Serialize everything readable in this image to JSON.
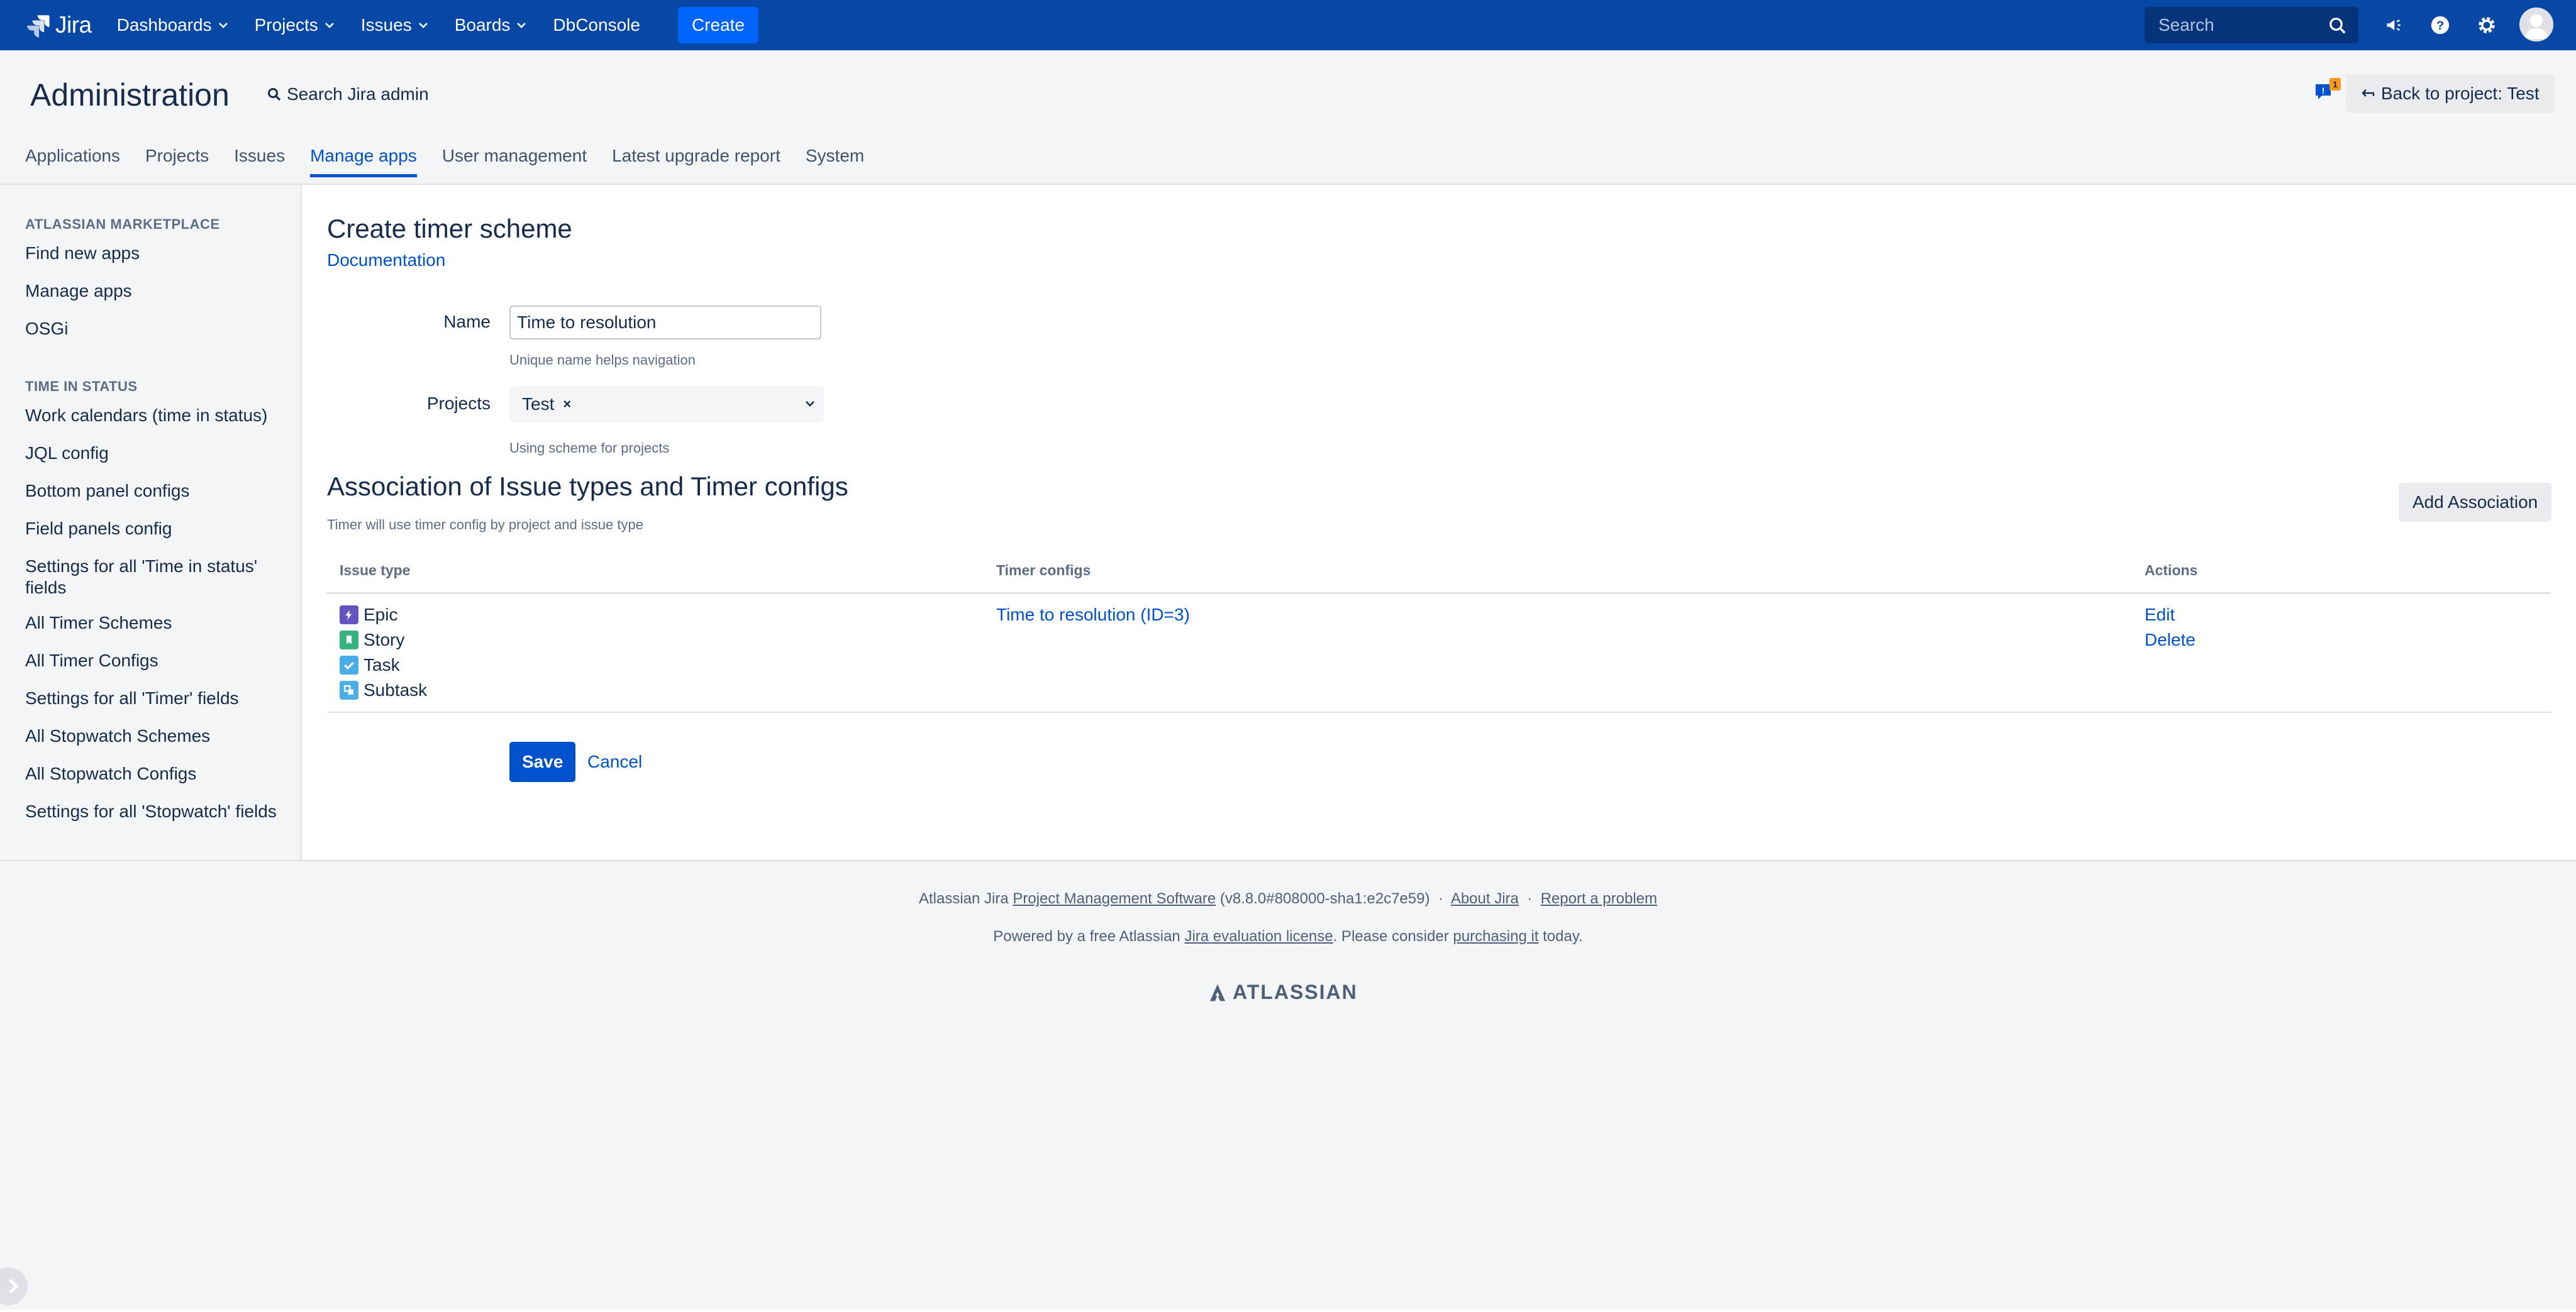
{
  "topnav": {
    "logo_text": "Jira",
    "items": [
      {
        "label": "Dashboards",
        "has_menu": true
      },
      {
        "label": "Projects",
        "has_menu": true
      },
      {
        "label": "Issues",
        "has_menu": true
      },
      {
        "label": "Boards",
        "has_menu": true
      },
      {
        "label": "DbConsole",
        "has_menu": false
      }
    ],
    "create_label": "Create",
    "search_placeholder": "Search",
    "notification_badge": "1"
  },
  "header": {
    "title": "Administration",
    "search_admin": "Search Jira admin",
    "back_button": "Back to project: Test"
  },
  "tabs": [
    {
      "label": "Applications",
      "active": false
    },
    {
      "label": "Projects",
      "active": false
    },
    {
      "label": "Issues",
      "active": false
    },
    {
      "label": "Manage apps",
      "active": true
    },
    {
      "label": "User management",
      "active": false
    },
    {
      "label": "Latest upgrade report",
      "active": false
    },
    {
      "label": "System",
      "active": false
    }
  ],
  "sidebar": {
    "marketplace_heading": "ATLASSIAN MARKETPLACE",
    "marketplace_items": [
      "Find new apps",
      "Manage apps",
      "OSGi"
    ],
    "tis_heading": "TIME IN STATUS",
    "tis_items": [
      "Work calendars (time in status)",
      "JQL config",
      "Bottom panel configs",
      "Field panels config",
      "Settings for all 'Time in status' fields",
      "All Timer Schemes",
      "All Timer Configs",
      "Settings for all 'Timer' fields",
      "All Stopwatch Schemes",
      "All Stopwatch Configs",
      "Settings for all 'Stopwatch' fields"
    ]
  },
  "form": {
    "title": "Create timer scheme",
    "documentation_link": "Documentation",
    "name_label": "Name",
    "name_value": "Time to resolution",
    "name_hint": "Unique name helps navigation",
    "projects_label": "Projects",
    "projects_selected": "Test",
    "projects_remove": "×",
    "projects_hint": "Using scheme for projects",
    "save_label": "Save",
    "cancel_label": "Cancel"
  },
  "association": {
    "title": "Association of Issue types and Timer configs",
    "subtitle": "Timer will use timer config by project and issue type",
    "add_button": "Add Association",
    "columns": {
      "issue_type": "Issue type",
      "timer_configs": "Timer configs",
      "actions": "Actions"
    },
    "rows": [
      {
        "issue_types": [
          {
            "label": "Epic",
            "icon": "epic-icon",
            "color": "#6554c0"
          },
          {
            "label": "Story",
            "icon": "story-icon",
            "color": "#36b37e"
          },
          {
            "label": "Task",
            "icon": "task-icon",
            "color": "#4bade8"
          },
          {
            "label": "Subtask",
            "icon": "subtask-icon",
            "color": "#4bade8"
          }
        ],
        "timer_config": "Time to resolution (ID=3)",
        "actions": [
          "Edit",
          "Delete"
        ]
      }
    ]
  },
  "footer": {
    "line1_prefix": "Atlassian Jira",
    "line1_link": "Project Management Software",
    "line1_version": "(v8.8.0#808000-sha1:e2c7e59)",
    "sep": "·",
    "about": "About Jira",
    "report": "Report a problem",
    "line2_prefix": "Powered by a free Atlassian",
    "line2_link": "Jira evaluation license",
    "line2_mid": ". Please consider",
    "line2_link2": "purchasing it",
    "line2_suffix": "today.",
    "brand": "ATLASSIAN"
  },
  "colors": {
    "nav_bg": "#0747a6",
    "link": "#0052cc",
    "create_btn": "#0065ff",
    "badge": "#ff991f"
  }
}
